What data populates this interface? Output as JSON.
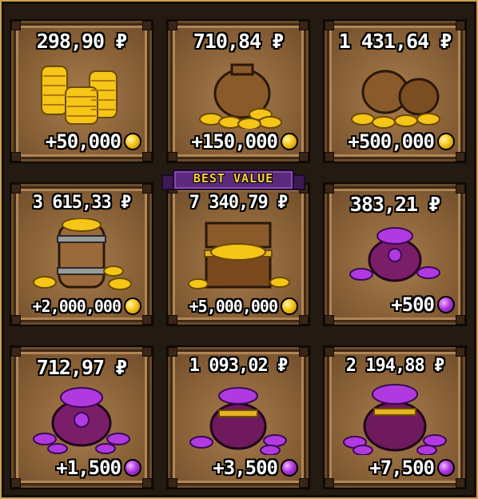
{
  "colors": {
    "gold_coin": "#f5c518",
    "gem": "#b03ae0",
    "card_bg": "#8a6238",
    "ribbon": "#5b2a7c",
    "ribbon_text": "#ffd23a"
  },
  "badge": {
    "label": "BEST VALUE"
  },
  "offers": [
    {
      "price": "298,90 ₽",
      "amount": "+50,000",
      "currency_icon": "gold-coin-icon",
      "art": "coin-stacks-icon"
    },
    {
      "price": "710,84 ₽",
      "amount": "+150,000",
      "currency_icon": "gold-coin-icon",
      "art": "coin-sack-icon"
    },
    {
      "price": "1 431,64 ₽",
      "amount": "+500,000",
      "currency_icon": "gold-coin-icon",
      "art": "coin-sacks-icon"
    },
    {
      "price": "3 615,33 ₽",
      "amount": "+2,000,000",
      "currency_icon": "gold-coin-icon",
      "art": "coin-barrel-icon"
    },
    {
      "price": "7 340,79 ₽",
      "amount": "+5,000,000",
      "currency_icon": "gold-coin-icon",
      "art": "treasure-chest-icon"
    },
    {
      "price": "383,21 ₽",
      "amount": "+500",
      "currency_icon": "gem-icon",
      "art": "gem-pouch-icon"
    },
    {
      "price": "712,97 ₽",
      "amount": "+1,500",
      "currency_icon": "gem-icon",
      "art": "gem-pouch-large-icon"
    },
    {
      "price": "1 093,02 ₽",
      "amount": "+3,500",
      "currency_icon": "gem-icon",
      "art": "gem-sack-icon"
    },
    {
      "price": "2 194,88 ₽",
      "amount": "+7,500",
      "currency_icon": "gem-icon",
      "art": "gem-sack-large-icon"
    }
  ]
}
